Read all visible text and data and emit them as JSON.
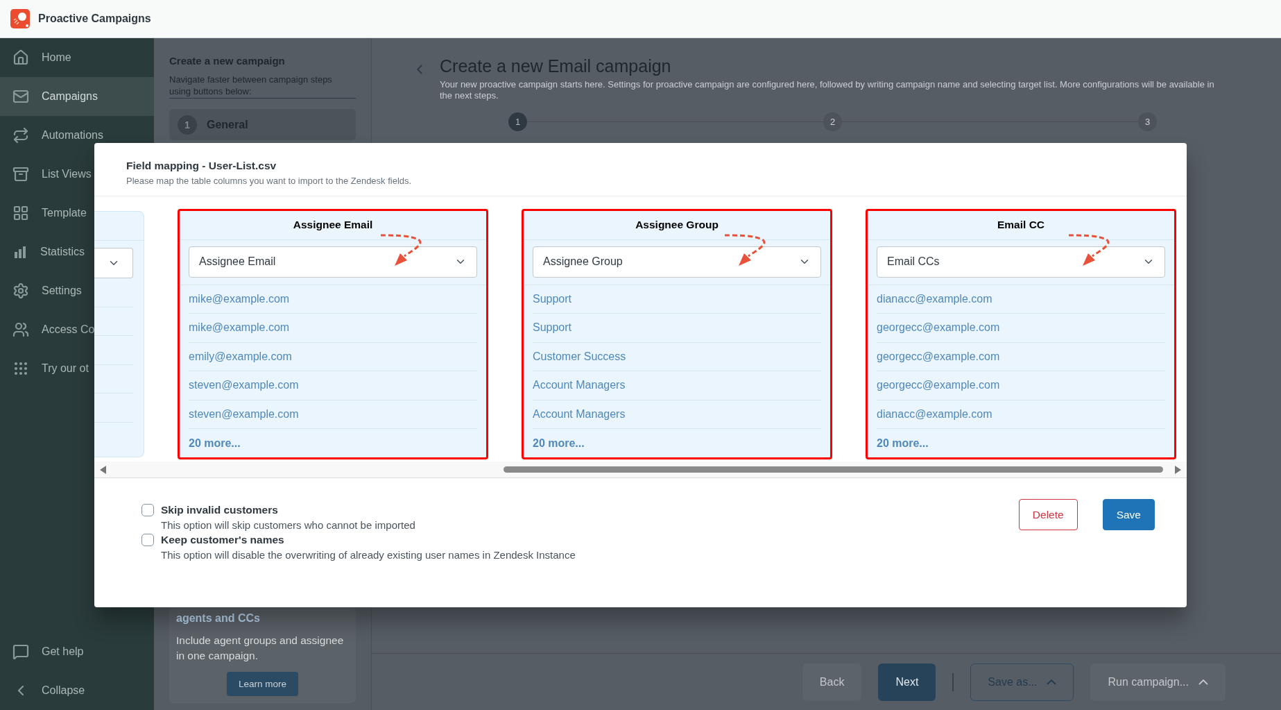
{
  "app": {
    "title": "Proactive Campaigns"
  },
  "sidebar": {
    "items": [
      {
        "label": "Home",
        "selected": false
      },
      {
        "label": "Campaigns",
        "selected": true
      },
      {
        "label": "Automations",
        "selected": false
      },
      {
        "label": "List Views",
        "selected": false
      },
      {
        "label": "Template",
        "selected": false
      },
      {
        "label": "Statistics",
        "selected": false
      },
      {
        "label": "Settings",
        "selected": false
      },
      {
        "label": "Access Co",
        "selected": false
      },
      {
        "label": "Try our ot",
        "selected": false
      }
    ],
    "footer": [
      {
        "label": "Get help"
      },
      {
        "label": "Collapse"
      }
    ]
  },
  "guide": {
    "title": "Create a new campaign",
    "description": "Navigate faster between campaign steps using buttons below:",
    "steps": [
      {
        "number": "1",
        "label": "General",
        "selected": true
      }
    ],
    "tip": {
      "title": "agents and CCs",
      "text": "Include agent groups and assignee in one campaign.",
      "button": "Learn more"
    }
  },
  "main": {
    "title": "Create a new Email campaign",
    "description": "Your new proactive campaign starts here. Settings for proactive campaign are configured here, followed by writing campaign name and selecting target list. More configurations will be available in the next steps.",
    "steps": [
      {
        "number": "1",
        "selected": true
      },
      {
        "number": "2",
        "selected": false
      },
      {
        "number": "3",
        "selected": false
      }
    ],
    "actions": [
      {
        "label": "Back",
        "kind": "ghost",
        "caret": false
      },
      {
        "label": "Next",
        "kind": "primary",
        "caret": false
      },
      {
        "label": "Save as...",
        "kind": "outline",
        "caret": true
      },
      {
        "label": "Run campaign...",
        "kind": "ghost",
        "caret": true
      }
    ]
  },
  "modal": {
    "title": "Field mapping - User-List.csv",
    "subtitle": "Please map the table columns you want to import to the Zendesk fields.",
    "columns": [
      {
        "heading": "Assignee Email",
        "selection": "Assignee Email",
        "highlighted": true,
        "values": [
          "mike@example.com",
          "mike@example.com",
          "emily@example.com",
          "steven@example.com",
          "steven@example.com"
        ],
        "more": "20 more..."
      },
      {
        "heading": "Assignee Group",
        "selection": "Assignee Group",
        "highlighted": true,
        "values": [
          "Support",
          "Support",
          "Customer Success",
          "Account Managers",
          "Account Managers"
        ],
        "more": "20 more..."
      },
      {
        "heading": "Email CC",
        "selection": "Email CCs",
        "highlighted": true,
        "values": [
          "dianacc@example.com",
          "georgecc@example.com",
          "georgecc@example.com",
          "georgecc@example.com",
          "dianacc@example.com"
        ],
        "more": "20 more..."
      }
    ],
    "options": [
      {
        "label": "Skip invalid customers",
        "description": "This option will skip customers who cannot be imported",
        "checked": false
      },
      {
        "label": "Keep customer's names",
        "description": "This option will disable the overwriting of already existing user names in Zendesk Instance",
        "checked": false
      }
    ],
    "buttons": [
      {
        "label": "Delete",
        "kind": "danger"
      },
      {
        "label": "Save",
        "kind": "primary"
      }
    ]
  }
}
